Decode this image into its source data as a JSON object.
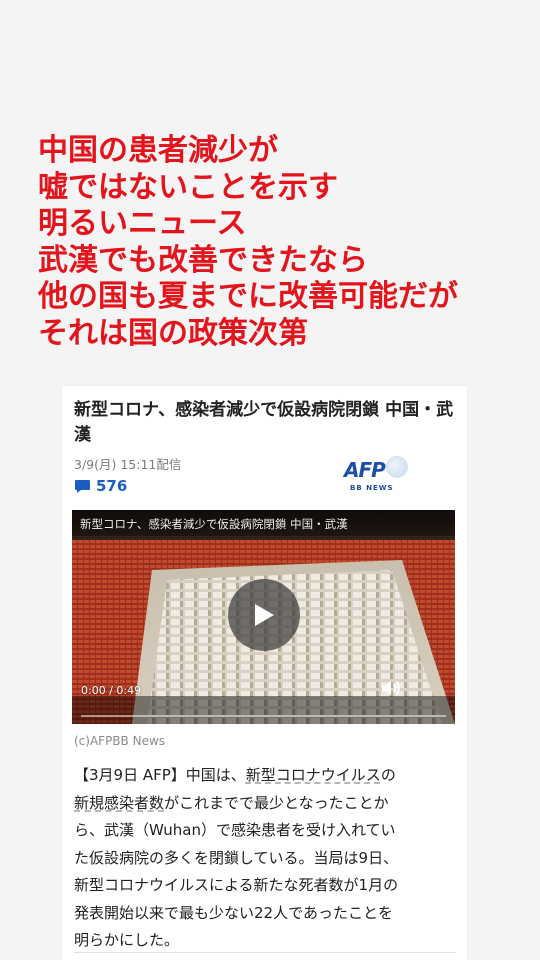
{
  "headline": {
    "lines": [
      "中国の患者減少が",
      "嘘ではないことを示す",
      "明るいニュース",
      "武漢でも改善できたなら",
      "他の国も夏までに改善可能だが",
      "それは国の政策次第"
    ],
    "color": "#e3141c"
  },
  "article": {
    "title": "新型コロナ、感染者減少で仮設病院閉鎖 中国・武漢",
    "date": "3/9(月) 15:11配信",
    "comment_count": "576",
    "comment_icon": "speech-bubble-icon",
    "source_logo": {
      "word": "AFP",
      "sub": "BB NEWS"
    },
    "accent_color": "#1a5fc0"
  },
  "video": {
    "title": "新型コロナ、感染者減少で仮設病院閉鎖 中国・武漢",
    "time": "0:00 / 0:49",
    "play_icon": "play-icon",
    "volume_icon": "volume-icon",
    "progress": 0
  },
  "credit": "(c)AFPBB News",
  "body": {
    "line1_pre": "【3月9日 AFP】中国は、",
    "line1_link": "新型コロナウイルス",
    "line1_post": "の",
    "line2_link": "新規感染者数",
    "line2_post": "がこれまでで最少となったことか",
    "line3": "ら、武漢（Wuhan）で感染患者を受け入れてい",
    "line4": "た仮設病院の多くを閉鎖している。当局は9日、",
    "line5": "新型コロナウイルスによる新たな死者数が1月の",
    "line6": "発表開始以来で最も少ない22人であったことを",
    "line7": "明らかにした。"
  }
}
